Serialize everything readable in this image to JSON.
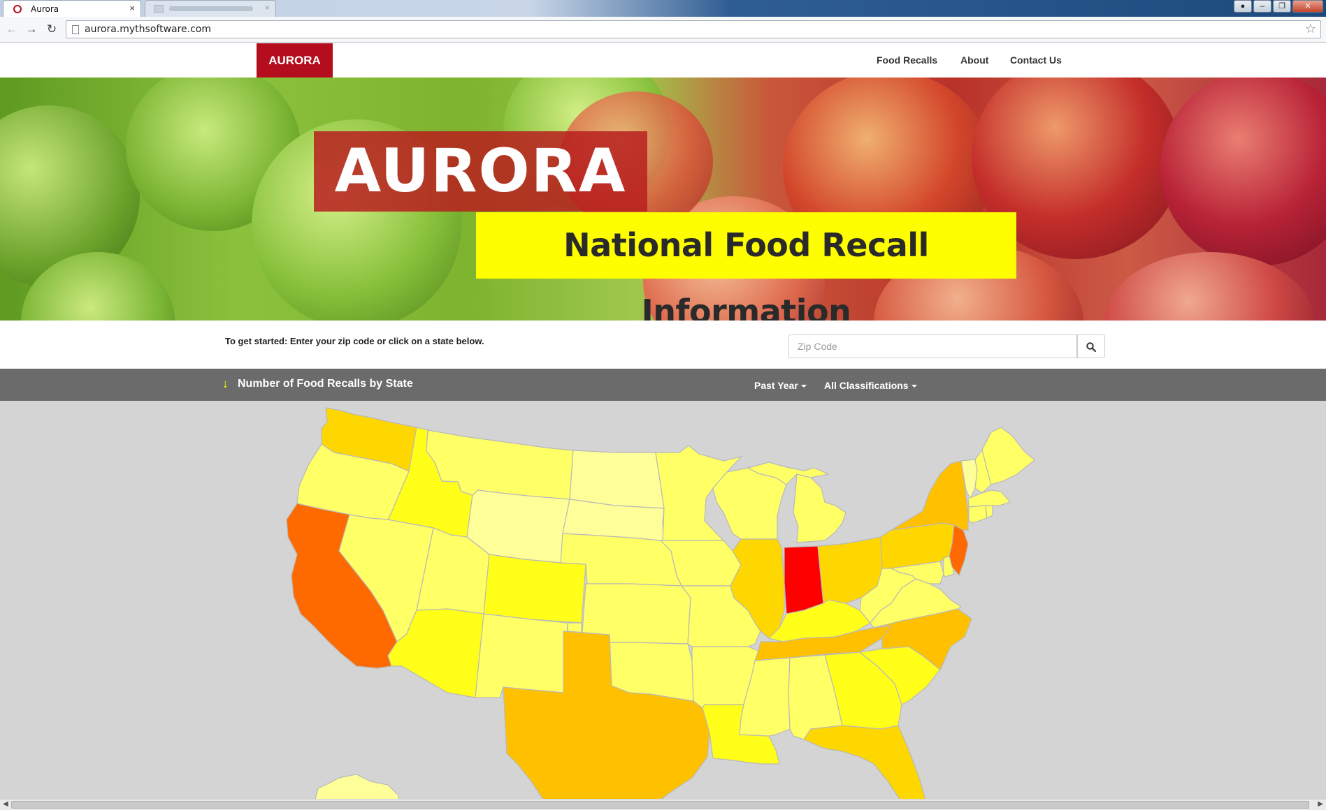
{
  "browser": {
    "tabs": [
      {
        "title": "Aurora",
        "active": true
      },
      {
        "title": "",
        "active": false
      }
    ],
    "url": "aurora.mythsoftware.com"
  },
  "navbar": {
    "brand": "AURORA",
    "links": [
      "Food Recalls",
      "About",
      "Contact Us"
    ],
    "brand_color": "#b40e1e"
  },
  "hero": {
    "title": "AURORA",
    "subtitle": "National Food Recall Information"
  },
  "intro": {
    "text": "To get started: Enter your zip code or click on a state below.",
    "zip_placeholder": "Zip Code"
  },
  "map_header": {
    "title": "Number of Food Recalls by State",
    "period": "Past Year",
    "classification": "All Classifications"
  },
  "map": {
    "colors": {
      "lightest": "#ffff99",
      "light": "#ffff66",
      "yellow": "#ffff1a",
      "gold": "#ffd700",
      "amber": "#ffc000",
      "orange": "#ff6a00",
      "red": "#ff0000"
    },
    "states": [
      {
        "code": "WA",
        "fill": "gold"
      },
      {
        "code": "OR",
        "fill": "light"
      },
      {
        "code": "CA",
        "fill": "orange"
      },
      {
        "code": "ID",
        "fill": "yellow"
      },
      {
        "code": "NV",
        "fill": "light"
      },
      {
        "code": "MT",
        "fill": "light"
      },
      {
        "code": "WY",
        "fill": "lightest"
      },
      {
        "code": "UT",
        "fill": "light"
      },
      {
        "code": "AZ",
        "fill": "yellow"
      },
      {
        "code": "CO",
        "fill": "yellow"
      },
      {
        "code": "NM",
        "fill": "light"
      },
      {
        "code": "ND",
        "fill": "lightest"
      },
      {
        "code": "SD",
        "fill": "lightest"
      },
      {
        "code": "NE",
        "fill": "light"
      },
      {
        "code": "KS",
        "fill": "light"
      },
      {
        "code": "OK",
        "fill": "light"
      },
      {
        "code": "TX",
        "fill": "amber"
      },
      {
        "code": "MN",
        "fill": "light"
      },
      {
        "code": "IA",
        "fill": "light"
      },
      {
        "code": "MO",
        "fill": "light"
      },
      {
        "code": "AR",
        "fill": "light"
      },
      {
        "code": "LA",
        "fill": "yellow"
      },
      {
        "code": "WI",
        "fill": "light"
      },
      {
        "code": "IL",
        "fill": "gold"
      },
      {
        "code": "MI",
        "fill": "light"
      },
      {
        "code": "IN",
        "fill": "red"
      },
      {
        "code": "OH",
        "fill": "gold"
      },
      {
        "code": "KY",
        "fill": "yellow"
      },
      {
        "code": "TN",
        "fill": "amber"
      },
      {
        "code": "MS",
        "fill": "light"
      },
      {
        "code": "AL",
        "fill": "light"
      },
      {
        "code": "GA",
        "fill": "yellow"
      },
      {
        "code": "FL",
        "fill": "gold"
      },
      {
        "code": "SC",
        "fill": "yellow"
      },
      {
        "code": "NC",
        "fill": "amber"
      },
      {
        "code": "VA",
        "fill": "light"
      },
      {
        "code": "WV",
        "fill": "light"
      },
      {
        "code": "PA",
        "fill": "gold"
      },
      {
        "code": "NY",
        "fill": "amber"
      },
      {
        "code": "NJ",
        "fill": "orange"
      },
      {
        "code": "MD",
        "fill": "light"
      },
      {
        "code": "DE",
        "fill": "light"
      },
      {
        "code": "VT",
        "fill": "lightest"
      },
      {
        "code": "NH",
        "fill": "light"
      },
      {
        "code": "ME",
        "fill": "light"
      },
      {
        "code": "MA",
        "fill": "light"
      },
      {
        "code": "CT",
        "fill": "light"
      },
      {
        "code": "RI",
        "fill": "light"
      },
      {
        "code": "AK",
        "fill": "lightest"
      }
    ]
  }
}
